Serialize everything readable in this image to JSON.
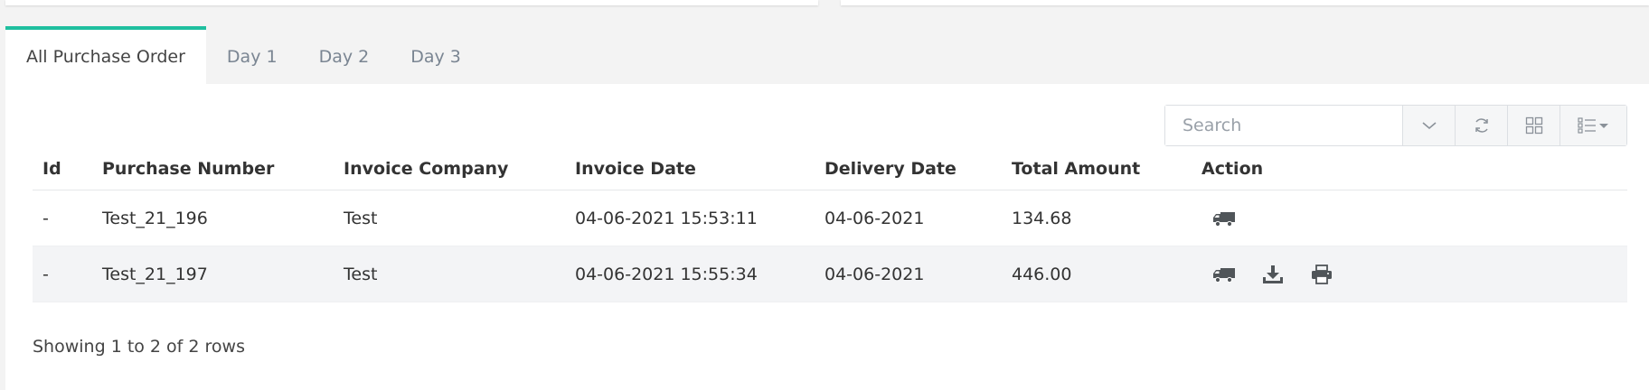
{
  "tabs": [
    {
      "label": "All Purchase Order"
    },
    {
      "label": "Day 1"
    },
    {
      "label": "Day 2"
    },
    {
      "label": "Day 3"
    }
  ],
  "toolbar": {
    "search_placeholder": "Search",
    "icons": [
      "chevron-down-icon",
      "refresh-icon",
      "grid-view-icon",
      "columns-list-icon"
    ]
  },
  "table": {
    "columns": [
      "Id",
      "Purchase Number",
      "Invoice Company",
      "Invoice Date",
      "Delivery Date",
      "Total Amount",
      "Action"
    ],
    "rows": [
      {
        "id": "-",
        "purchase_number": "Test_21_196",
        "invoice_company": "Test",
        "invoice_date": "04-06-2021 15:53:11",
        "delivery_date": "04-06-2021",
        "total_amount": "134.68",
        "actions": [
          "truck-icon"
        ]
      },
      {
        "id": "-",
        "purchase_number": "Test_21_197",
        "invoice_company": "Test",
        "invoice_date": "04-06-2021 15:55:34",
        "delivery_date": "04-06-2021",
        "total_amount": "446.00",
        "actions": [
          "truck-icon",
          "download-icon",
          "print-icon"
        ]
      }
    ]
  },
  "footer": {
    "summary": "Showing 1 to 2 of 2 rows"
  },
  "colors": {
    "accent": "#1fbf9f",
    "row_alt": "#f3f4f6"
  }
}
